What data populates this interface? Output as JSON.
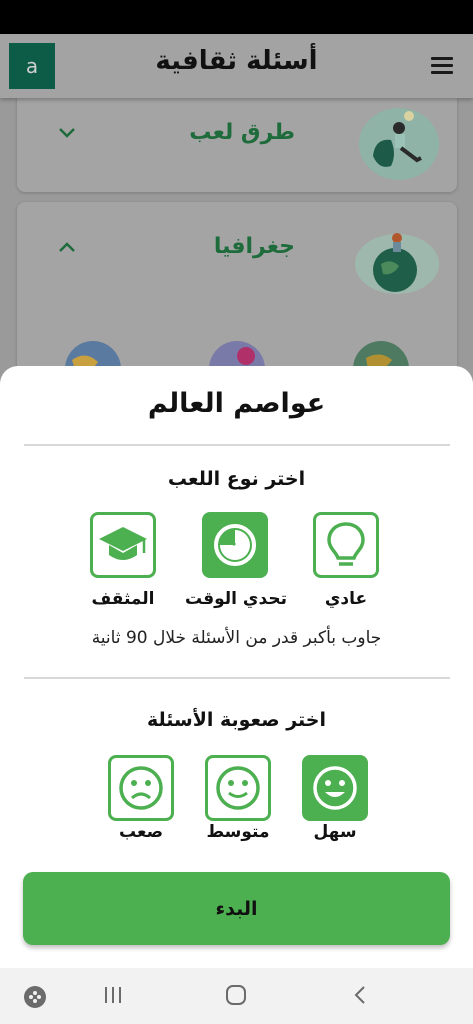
{
  "app": {
    "title": "أسئلة ثقافية",
    "avatar_letter": "a"
  },
  "categories": [
    {
      "label": "طرق لعب",
      "state": "collapsed"
    },
    {
      "label": "جغرافيا",
      "state": "expanded"
    }
  ],
  "sheet": {
    "title": "عواصم العالم",
    "mode_section": {
      "heading": "اختر نوع اللعب",
      "options": [
        {
          "label": "عادي",
          "icon": "lightbulb-icon",
          "selected": false
        },
        {
          "label": "تحدي الوقت",
          "icon": "timer-icon",
          "selected": true
        },
        {
          "label": "المثقف",
          "icon": "graduation-cap-icon",
          "selected": false
        }
      ],
      "description": "جاوب بأكبر قدر من الأسئلة خلال 90 ثانية"
    },
    "difficulty_section": {
      "heading": "اختر صعوبة الأسئلة",
      "options": [
        {
          "label": "سهل",
          "icon": "happy-face-icon",
          "selected": true
        },
        {
          "label": "متوسط",
          "icon": "smile-face-icon",
          "selected": false
        },
        {
          "label": "صعب",
          "icon": "sad-face-icon",
          "selected": false
        }
      ]
    },
    "start_label": "البدء"
  },
  "colors": {
    "accent": "#4caf50",
    "dark_green": "#0d5c47",
    "category_text": "#1e6b3b"
  }
}
